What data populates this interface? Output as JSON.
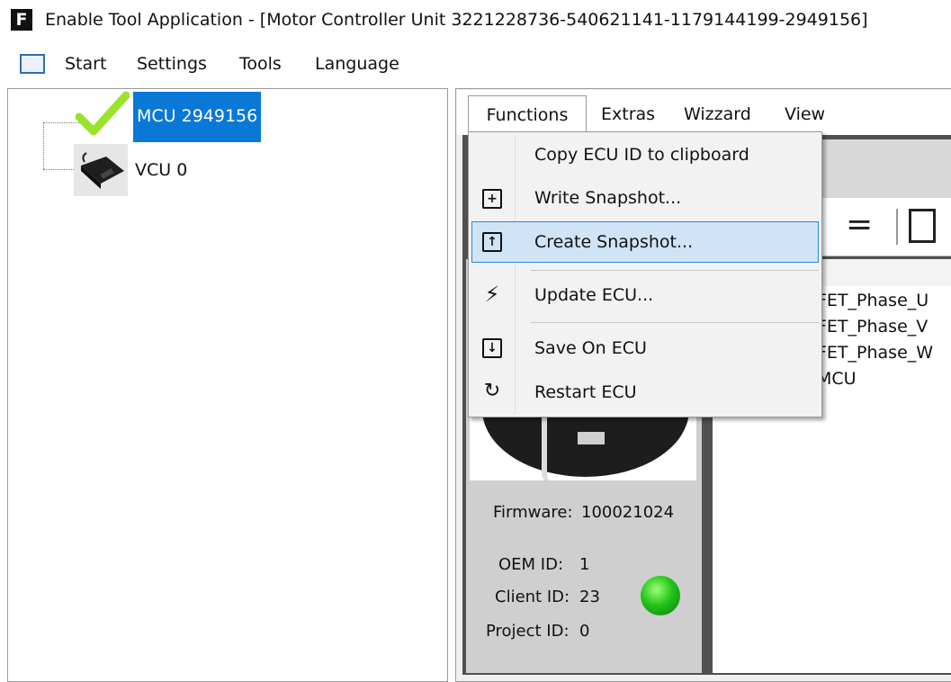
{
  "window": {
    "logo": "F",
    "title": "Enable Tool Application - [Motor Controller Unit 3221228736-540621141-1179144199-2949156]"
  },
  "menubar": {
    "items": [
      "Start",
      "Settings",
      "Tools",
      "Language"
    ]
  },
  "tree": {
    "nodes": [
      {
        "label": "MCU 2949156",
        "selected": true,
        "icon": "checkmark-icon"
      },
      {
        "label": "VCU 0",
        "selected": false,
        "icon": "vcu-device-icon"
      }
    ]
  },
  "tabs": [
    "Functions",
    "Extras",
    "Wizzard",
    "View"
  ],
  "functions_menu": {
    "items": [
      {
        "label": "Copy ECU ID to clipboard",
        "icon": ""
      },
      {
        "label": "Write Snapshot...",
        "icon": "write-snapshot-icon"
      },
      {
        "label": "Create Snapshot...",
        "icon": "create-snapshot-icon",
        "highlighted": true
      },
      {
        "label": "Update ECU...",
        "icon": "lightning-icon"
      },
      {
        "label": "Save On ECU",
        "icon": "save-on-ecu-icon"
      },
      {
        "label": "Restart ECU",
        "icon": "restart-icon"
      }
    ]
  },
  "signal_list": [
    "FET_Phase_U",
    "FET_Phase_V",
    "FET_Phase_W",
    "MCU"
  ],
  "device_info": {
    "firmware_label": "Firmware:",
    "firmware_value": "100021024",
    "oem_label": "OEM ID:",
    "oem_value": "1",
    "client_label": "Client ID:",
    "client_value": "23",
    "project_label": "Project ID:",
    "project_value": "0",
    "status": "green"
  },
  "colors": {
    "selection": "#0a78d7",
    "menu_highlight": "#cfe4f7",
    "status_led": "#23c51a",
    "check": "#9be22d"
  }
}
